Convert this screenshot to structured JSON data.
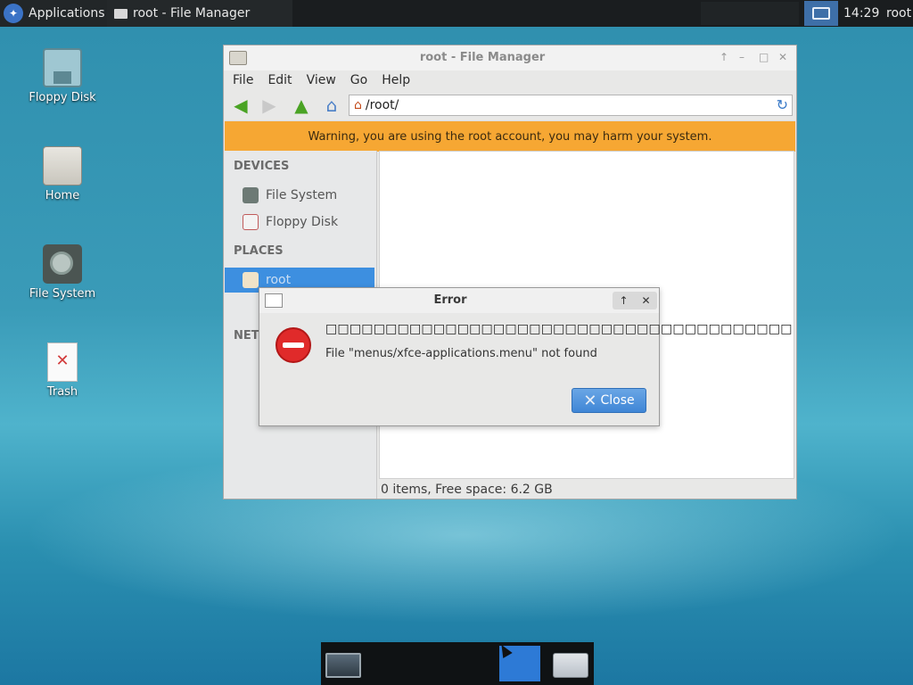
{
  "top_panel": {
    "applications_label": "Applications",
    "task_title": "root - File Manager",
    "clock": "14:29",
    "user": "root"
  },
  "desktop_icons": [
    {
      "label": "Floppy Disk",
      "icon": "floppy-icon"
    },
    {
      "label": "Home",
      "icon": "folder-icon"
    },
    {
      "label": "File System",
      "icon": "disk-icon"
    },
    {
      "label": "Trash",
      "icon": "trash-icon"
    }
  ],
  "file_manager": {
    "title": "root - File Manager",
    "menu": [
      "File",
      "Edit",
      "View",
      "Go",
      "Help"
    ],
    "location": "/root/",
    "warning": "Warning, you are using the root account, you may harm your system.",
    "sidebar": {
      "devices_header": "DEVICES",
      "devices": [
        "File System",
        "Floppy Disk"
      ],
      "places_header": "PLACES",
      "places": [
        "root"
      ],
      "network_header": "NET"
    },
    "status": "0 items, Free space: 6.2 GB"
  },
  "error_dialog": {
    "title": "Error",
    "primary_text": "□□□□□□□□□□□□□□□□□□□□□□□□□□□□□□□□□□□□□□□",
    "secondary_text": "File \"menus/xfce-applications.menu\" not found",
    "close_label": "Close"
  },
  "colors": {
    "warning_bar": "#f6a733",
    "selection": "#3d8fe0",
    "panel": "#1a1d1f"
  }
}
